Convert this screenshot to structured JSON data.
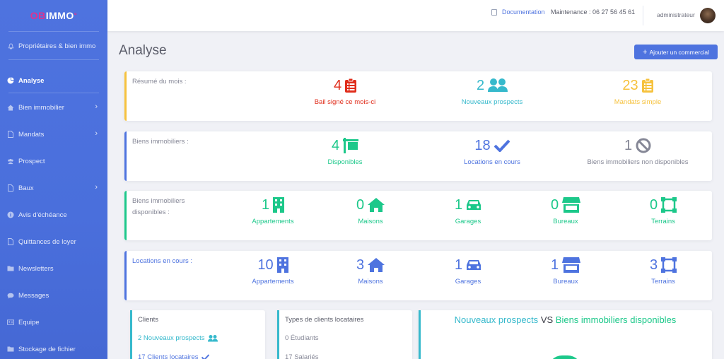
{
  "brand": {
    "part1": "OB",
    "part2": "IMMO",
    "part3": "°"
  },
  "sidebar": {
    "items": [
      {
        "label": "Propriétaires & bien immo",
        "icon": "bell-icon",
        "chevron": false
      },
      {
        "label": "Analyse",
        "icon": "pie-chart-icon",
        "chevron": false,
        "active": true
      },
      {
        "label": "Bien immobilier",
        "icon": "home-icon",
        "chevron": true
      },
      {
        "label": "Mandats",
        "icon": "file-icon",
        "chevron": true
      },
      {
        "label": "Prospect",
        "icon": "users-icon",
        "chevron": false
      },
      {
        "label": "Baux",
        "icon": "file-icon",
        "chevron": true
      },
      {
        "label": "Avis d'échéance",
        "icon": "info-icon",
        "chevron": false
      },
      {
        "label": "Quittances de loyer",
        "icon": "file-icon",
        "chevron": false
      },
      {
        "label": "Newsletters",
        "icon": "folder-icon",
        "chevron": false
      },
      {
        "label": "Messages",
        "icon": "comment-icon",
        "chevron": false
      },
      {
        "label": "Equipe",
        "icon": "id-card-icon",
        "chevron": false
      },
      {
        "label": "Stockage de fichier",
        "icon": "folder-icon",
        "chevron": false
      }
    ]
  },
  "topbar": {
    "documentation": "Documentation",
    "maintenance": "Maintenance : 06 27 56 45 61",
    "user": "administrateur"
  },
  "page": {
    "title": "Analyse",
    "add_button": "Ajouter un commercial"
  },
  "cards": {
    "resume": {
      "label": "Résumé du mois :",
      "stats": [
        {
          "value": "4",
          "caption": "Bail signé ce mois-ci",
          "color": "#e02d1b",
          "icon": "clipboard-list-icon"
        },
        {
          "value": "2",
          "caption": "Nouveaux prospects",
          "color": "#36b9cc",
          "icon": "users-icon"
        },
        {
          "value": "23",
          "caption": "Mandats simple",
          "color": "#f6c23e",
          "icon": "clipboard-list-icon"
        }
      ]
    },
    "biens": {
      "label": "Biens immobiliers :",
      "stats": [
        {
          "value": "4",
          "caption": "Disponibles",
          "color": "#1cc88a",
          "icon": "sign-icon"
        },
        {
          "value": "18",
          "caption": "Locations en cours",
          "color": "#4e73df",
          "icon": "check-icon"
        },
        {
          "value": "1",
          "caption": "Biens immobiliers non disponibles",
          "color": "#858796",
          "icon": "ban-icon"
        }
      ]
    },
    "disponibles": {
      "label_line1": "Biens immobiliers",
      "label_line2": "disponibles :",
      "stats": [
        {
          "value": "1",
          "caption": "Appartements",
          "icon": "building-icon"
        },
        {
          "value": "0",
          "caption": "Maisons",
          "icon": "home-icon"
        },
        {
          "value": "1",
          "caption": "Garages",
          "icon": "car-icon"
        },
        {
          "value": "0",
          "caption": "Bureaux",
          "icon": "store-icon"
        },
        {
          "value": "0",
          "caption": "Terrains",
          "icon": "vector-square-icon"
        }
      ]
    },
    "locations": {
      "label": "Locations en cours :",
      "stats": [
        {
          "value": "10",
          "caption": "Appartements",
          "icon": "building-icon"
        },
        {
          "value": "3",
          "caption": "Maisons",
          "icon": "home-icon"
        },
        {
          "value": "1",
          "caption": "Garages",
          "icon": "car-icon"
        },
        {
          "value": "1",
          "caption": "Bureaux",
          "icon": "store-icon"
        },
        {
          "value": "3",
          "caption": "Terrains",
          "icon": "vector-square-icon"
        }
      ]
    }
  },
  "panels": {
    "clients": {
      "title": "Clients",
      "row1": "2 Nouveaux prospects",
      "row2": "17 Clients locataires"
    },
    "types": {
      "title": "Types de clients locataires",
      "row1": "0 Étudiants",
      "row2": "17 Salariés"
    },
    "chart": {
      "part1": "Nouveaux prospects",
      "part2": "VS",
      "part3": "Biens immobiliers disponibles"
    }
  },
  "colors": {
    "primary": "#4e73df",
    "success": "#1cc88a",
    "info": "#36b9cc",
    "warning": "#f6c23e",
    "danger": "#e02d1b"
  }
}
